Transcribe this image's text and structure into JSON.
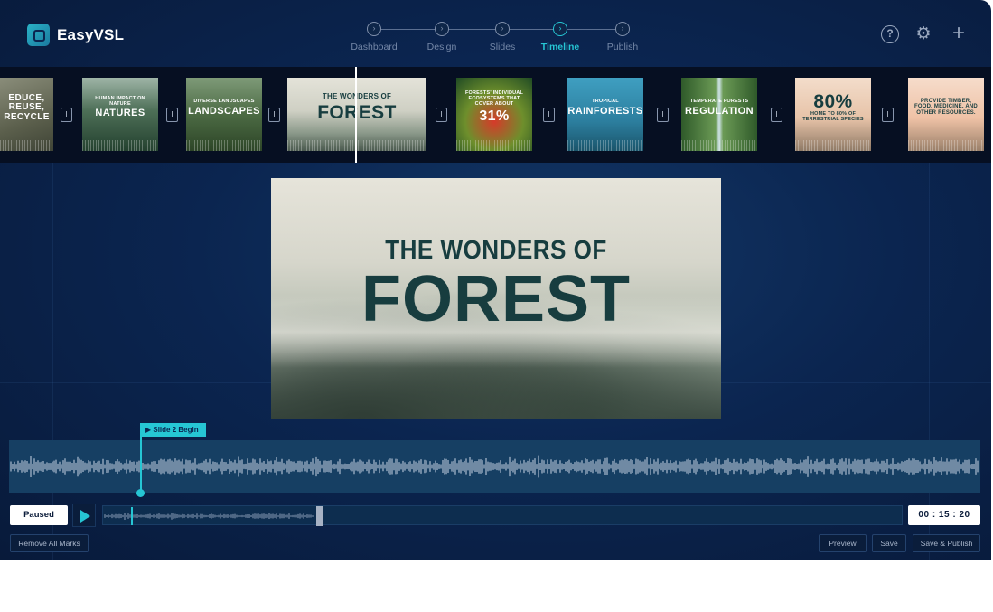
{
  "app": {
    "name": "EasyVSL"
  },
  "steps": [
    {
      "label": "Dashboard",
      "active": false
    },
    {
      "label": "Design",
      "active": false
    },
    {
      "label": "Slides",
      "active": false
    },
    {
      "label": "Timeline",
      "active": true
    },
    {
      "label": "Publish",
      "active": false
    }
  ],
  "header_icons": [
    "help-icon",
    "gear-icon",
    "plus-icon"
  ],
  "slides": [
    {
      "small": "",
      "big": "EDUCE, REUSE, RECYCLE"
    },
    {
      "small": "HUMAN IMPACT ON NATURE",
      "big": "NATURES"
    },
    {
      "small": "DIVERSE LANDSCAPES",
      "big": "LANDSCAPES"
    },
    {
      "small": "THE WONDERS OF",
      "big": "FOREST"
    },
    {
      "small": "FORESTS' INDIVIDUAL ECOSYSTEMS THAT COVER ABOUT",
      "big": "31%"
    },
    {
      "small": "TROPICAL",
      "big": "RAINFORESTS"
    },
    {
      "small": "TEMPERATE FORESTS",
      "big": "REGULATION"
    },
    {
      "small": "HOME TO 80% OF TERRESTRIAL SPECIES",
      "big": "80%"
    },
    {
      "small": "",
      "big": "PROVIDE TIMBER, FOOD, MEDICINE, AND OTHER RESOURCES."
    }
  ],
  "separator_glyph": "I",
  "preview": {
    "line1": "THE WONDERS OF",
    "line2": "FOREST"
  },
  "timeline": {
    "marker_label": "▶ Slide 2 Begin",
    "status": "Paused",
    "time": "00 : 15 : 20"
  },
  "actions": {
    "remove_marks": "Remove All Marks",
    "preview": "Preview",
    "save": "Save",
    "save_publish": "Save & Publish"
  }
}
